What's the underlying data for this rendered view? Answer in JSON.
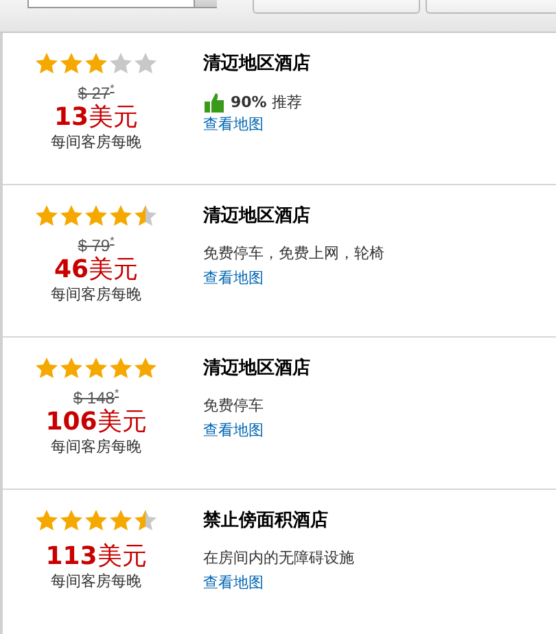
{
  "hotels": [
    {
      "stars": 3,
      "original_price": "$ 27",
      "original_mark": "*",
      "price_number": "13",
      "price_unit": "美元",
      "price_note": "每间客房每晚",
      "name": "清迈地区酒店",
      "kind": "rating",
      "rating": "90%",
      "rating_label": "推荐",
      "map_link": "查看地图"
    },
    {
      "stars": 4.5,
      "original_price": "$ 79",
      "original_mark": "*",
      "price_number": "46",
      "price_unit": "美元",
      "price_note": "每间客房每晚",
      "name": "清迈地区酒店",
      "kind": "amenities",
      "amenities": "免费停车，免费上网，轮椅",
      "map_link": "查看地图"
    },
    {
      "stars": 5,
      "original_price": "$ 148",
      "original_mark": "*",
      "price_number": "106",
      "price_unit": "美元",
      "price_note": "每间客房每晚",
      "name": "清迈地区酒店",
      "kind": "amenities",
      "amenities": "免费停车",
      "map_link": "查看地图"
    },
    {
      "stars": 4.5,
      "price_number": "113",
      "price_unit": "美元",
      "price_note": "每间客房每晚",
      "name": "禁止傍面积酒店",
      "kind": "amenities",
      "amenities": "在房间内的无障碍设施",
      "map_link": "查看地图"
    }
  ]
}
